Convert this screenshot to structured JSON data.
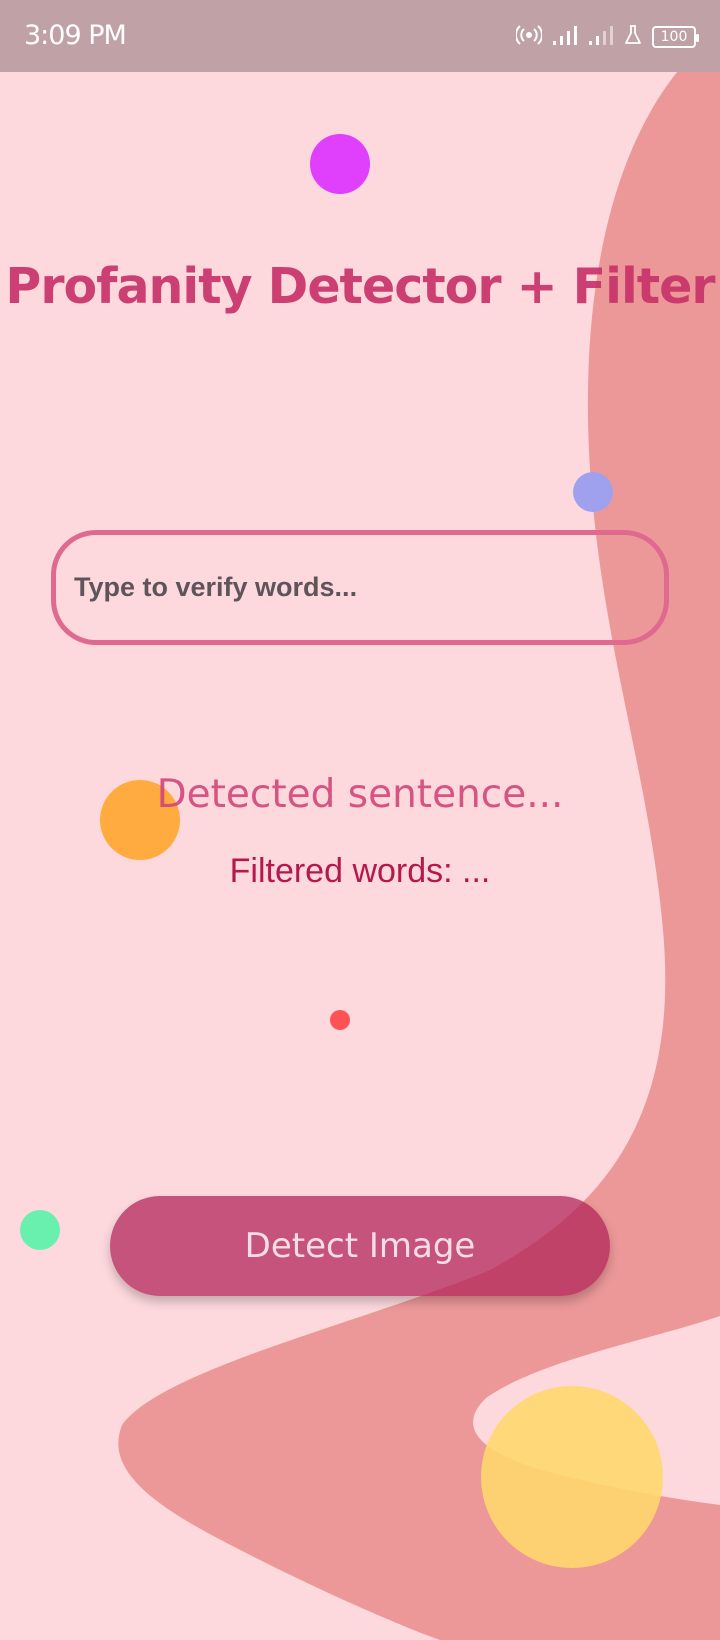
{
  "status_bar": {
    "time": "3:09 PM",
    "battery": "100",
    "icons": [
      "hotspot-icon",
      "signal-icon",
      "signal-weak-icon",
      "lab-flask-icon",
      "battery-icon"
    ]
  },
  "title": "Profanity Detector + Filter",
  "input": {
    "placeholder": "Type to verify words...",
    "value": ""
  },
  "detected_sentence": "Detected sentence...",
  "filtered_words": "Filtered words: ...",
  "button": {
    "label": "Detect Image"
  },
  "colors": {
    "background": "#fdd9de",
    "wave": "#ec9898",
    "title": "#c8336a",
    "accent": "#b5184d",
    "button": "#b12458"
  }
}
